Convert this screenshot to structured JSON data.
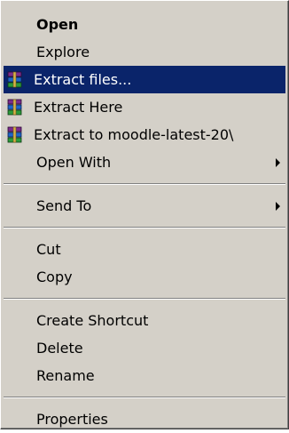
{
  "menu": {
    "items": [
      {
        "label": "Open"
      },
      {
        "label": "Explore"
      },
      {
        "label": "Extract files..."
      },
      {
        "label": "Extract Here"
      },
      {
        "label": "Extract to moodle-latest-20\\"
      },
      {
        "label": "Open With"
      },
      {
        "label": "Send To"
      },
      {
        "label": "Cut"
      },
      {
        "label": "Copy"
      },
      {
        "label": "Create Shortcut"
      },
      {
        "label": "Delete"
      },
      {
        "label": "Rename"
      },
      {
        "label": "Properties"
      }
    ],
    "selected_label": "Extract files...",
    "icons": {
      "archive": "winrar-archive-icon",
      "submenu": "submenu-arrow-icon"
    },
    "colors": {
      "menu_bg": "#d4d0c8",
      "highlight_bg": "#0a246a",
      "highlight_text": "#ffffff"
    }
  }
}
